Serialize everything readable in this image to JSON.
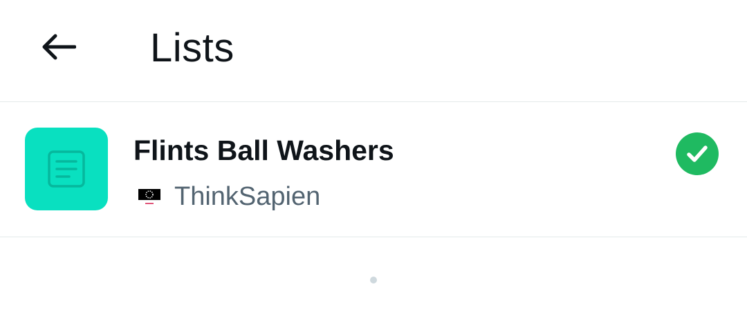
{
  "header": {
    "title": "Lists",
    "back_icon": "arrow-left-icon"
  },
  "lists": [
    {
      "name": "Flints Ball Washers",
      "owner": "ThinkSapien",
      "avatar_icon": "list-document-icon",
      "owner_avatar_icon": "profile-image",
      "selected": true,
      "status_icon": "checkmark-circle-icon"
    }
  ],
  "colors": {
    "list_avatar_bg": "#09e0c0",
    "list_avatar_icon": "#06b89d",
    "check_green": "#1fba61",
    "text_primary": "#0f1419",
    "text_secondary": "#536471",
    "divider": "#e4eaea"
  }
}
